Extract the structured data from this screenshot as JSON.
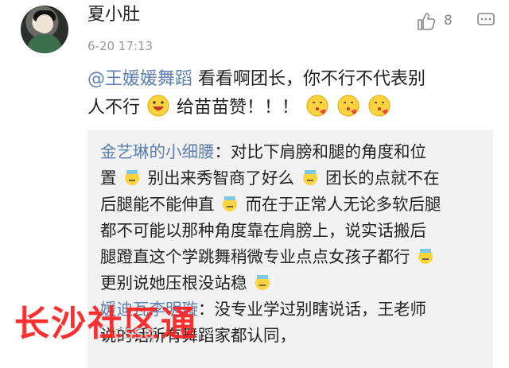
{
  "comment": {
    "username": "夏小肚",
    "timestamp": "6-20 17:13",
    "like_count": "8",
    "mention": "@王媛媛舞蹈",
    "text_line1": " 看看啊团长，你不行不代表别",
    "text_line2": "人不行",
    "text_line2_after": " 给苗苗赞！！！",
    "icons": [
      "avatar",
      "thumbs-up-icon",
      "comment-icon",
      "laugh-emoji-icon",
      "kiss-emoji-icon"
    ]
  },
  "quoted": {
    "name1": "金艺琳的小细腰",
    "l1": "：对比下肩膀和腿的角度和位",
    "l2a": "置",
    "l2b": "别出来秀智商了好么",
    "l2c": "团长的点就不在",
    "l3a": "后腿能不能伸直",
    "l3b": "而在于正常人无论多软后腿",
    "l4": "都不可能以那种角度靠在肩膀上，说实话搬后",
    "l5": "腿蹬直这个学跳舞稍微专业点点女孩子都行",
    "l6": "更别说她压根没站稳",
    "name2": "媛迪瓦李明璇",
    "l7": "：没专业学过别瞎说话，王老师",
    "l8": "说的话所有舞蹈家都认同，"
  },
  "watermark": {
    "text": "长沙社区通",
    "url": "cssq"
  },
  "colors": {
    "mention": "#5d80b2",
    "quote_bg": "#f2f2f2",
    "watermark": "#ff1f1f"
  }
}
